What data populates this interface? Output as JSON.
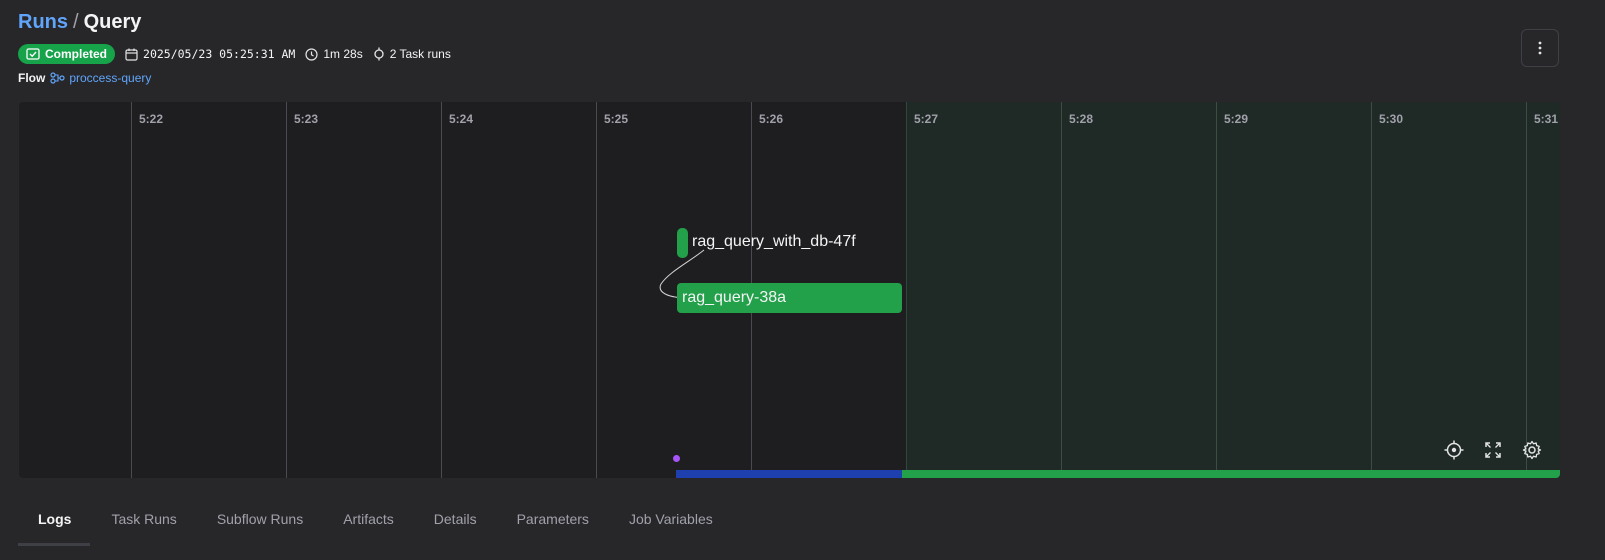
{
  "breadcrumb": {
    "root": "Runs",
    "separator": "/",
    "current": "Query"
  },
  "status": {
    "label": "Completed",
    "color": "#16a34a"
  },
  "meta": {
    "start_time": "2025/05/23 05:25:31 AM",
    "duration": "1m 28s",
    "task_runs": "2 Task runs"
  },
  "flow": {
    "label": "Flow",
    "name": "proccess-query"
  },
  "timeline": {
    "ticks": [
      "5:22",
      "5:23",
      "5:24",
      "5:25",
      "5:26",
      "5:27",
      "5:28",
      "5:29",
      "5:30",
      "5:31"
    ],
    "nodes": [
      {
        "name": "rag_query_with_db-47f"
      },
      {
        "name": "rag_query-38a"
      }
    ],
    "state_colors": {
      "running": "#1e40af",
      "completed": "#22a04a",
      "event": "#a855f7"
    },
    "controls": [
      "recenter-icon",
      "fullscreen-icon",
      "settings-icon"
    ]
  },
  "tabs": [
    "Logs",
    "Task Runs",
    "Subflow Runs",
    "Artifacts",
    "Details",
    "Parameters",
    "Job Variables"
  ],
  "active_tab": "Logs"
}
